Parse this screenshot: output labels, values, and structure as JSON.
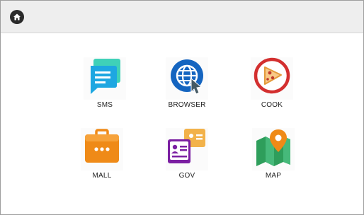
{
  "topbar": {
    "home_icon": "home-icon",
    "home_icon_bg": "#2a2a2a"
  },
  "apps": [
    {
      "label": "SMS",
      "icon": "sms-icon",
      "color": "#1ea7e1"
    },
    {
      "label": "BROWSER",
      "icon": "browser-globe-icon",
      "color": "#1565c0"
    },
    {
      "label": "COOK",
      "icon": "pizza-icon",
      "color": "#d32f2f"
    },
    {
      "label": "MALL",
      "icon": "shopping-bag-icon",
      "color": "#ef8a17"
    },
    {
      "label": "GOV",
      "icon": "id-card-icon",
      "color": "#7b1fa2"
    },
    {
      "label": "MAP",
      "icon": "map-pin-icon",
      "color": "#2e9e5b"
    }
  ]
}
